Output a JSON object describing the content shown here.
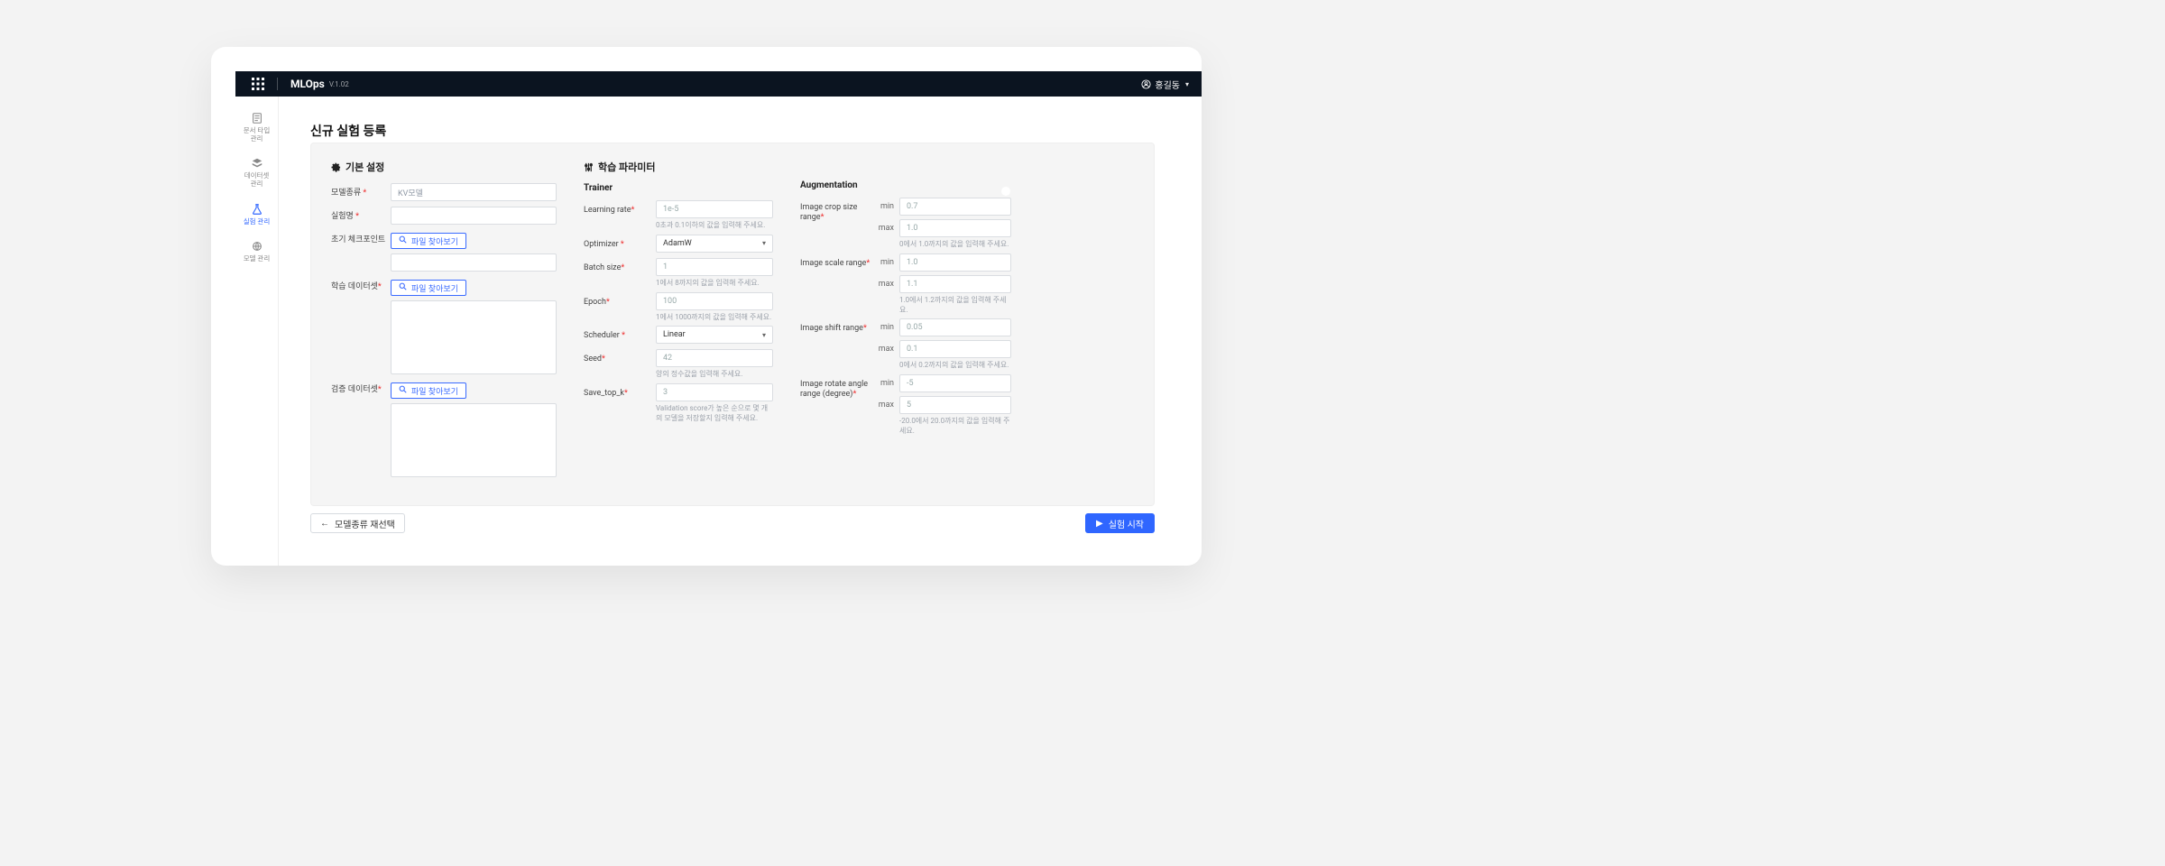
{
  "header": {
    "brand": "MLOps",
    "version": "V.1.02",
    "user_name": "홍길동"
  },
  "sidebar": {
    "items": [
      {
        "label_l1": "문서 타입",
        "label_l2": "관리"
      },
      {
        "label_l1": "데이터셋",
        "label_l2": "관리"
      },
      {
        "label_l1": "실험 관리",
        "label_l2": ""
      },
      {
        "label_l1": "모델 관리",
        "label_l2": ""
      }
    ]
  },
  "page": {
    "title": "신규 실험 등록"
  },
  "basic": {
    "section_title": "기본 설정",
    "fields": {
      "model_type_label": "모델종류",
      "model_type_value": "KV모델",
      "exp_name_label": "실험명",
      "exp_name_value": "",
      "init_ckpt_label": "초기 체크포인트",
      "train_ds_label": "학습 데이터셋",
      "valid_ds_label": "검증 데이터셋"
    },
    "file_button_label": "파일 찾아보기"
  },
  "params": {
    "section_title": "학습 파라미터",
    "trainer": {
      "title": "Trainer",
      "learning_rate": {
        "label": "Learning rate",
        "placeholder": "1e-5",
        "help": "0초과 0.1이하의 값을 입력해 주세요."
      },
      "optimizer": {
        "label": "Optimizer",
        "value": "AdamW"
      },
      "batch_size": {
        "label": "Batch size",
        "placeholder": "1",
        "help": "1에서 8까지의 값을 입력해 주세요."
      },
      "epoch": {
        "label": "Epoch",
        "placeholder": "100",
        "help": "1에서 1000까지의 값을 입력해 주세요."
      },
      "scheduler": {
        "label": "Scheduler",
        "value": "Linear"
      },
      "seed": {
        "label": "Seed",
        "placeholder": "42",
        "help": "양의 정수값을 입력해 주세요."
      },
      "save_top_k": {
        "label": "Save_top_k",
        "placeholder": "3",
        "help": "Validation score가 높은 순으로 몇 개의 모델을 저장할지 입력해 주세요."
      }
    },
    "augmentation": {
      "title": "Augmentation",
      "enabled": true,
      "min_label": "min",
      "max_label": "max",
      "crop": {
        "label": "Image crop size range",
        "min_ph": "0.7",
        "max_ph": "1.0",
        "help": "0에서 1.0까지의 값을 입력해 주세요."
      },
      "scale": {
        "label": "Image scale range",
        "min_ph": "1.0",
        "max_ph": "1.1",
        "help": "1.0에서 1.2까지의 값을 입력해 주세요."
      },
      "shift": {
        "label": "Image shift range",
        "min_ph": "0.05",
        "max_ph": "0.1",
        "help": "0에서 0.2까지의 값을 입력해 주세요."
      },
      "rotate": {
        "label": "Image rotate angle range (degree)",
        "min_ph": "-5",
        "max_ph": "5",
        "help": "-20.0에서 20.0까지의 값을 입력해 주세요."
      }
    }
  },
  "footer": {
    "back_label": "모델종류 재선택",
    "start_label": "실험 시작"
  }
}
